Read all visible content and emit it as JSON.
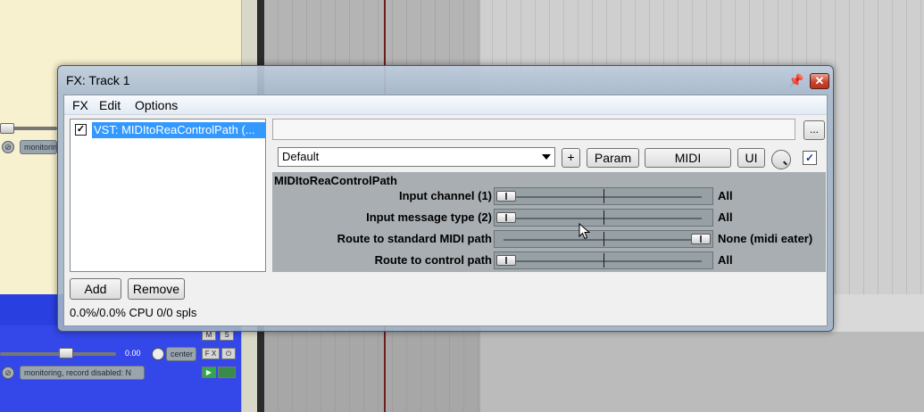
{
  "background": {
    "track": {
      "volume": "0.00",
      "pan": "center",
      "fx_label": "F X",
      "monitor_top": "monitoring",
      "monitor_bottom": "monitoring, record disabled: N",
      "mute": "M",
      "solo": "S",
      "rec_icon": "record-disabled-icon",
      "phase_icon": "phase-invert-icon"
    }
  },
  "fx_window": {
    "title": "FX: Track 1",
    "pin_icon": "pin-icon",
    "close_icon": "close-icon",
    "close_glyph": "✕",
    "menu": [
      "FX",
      "Edit",
      "Options"
    ],
    "fx_list": [
      {
        "label": "VST: MIDItoReaControlPath (...",
        "enabled": true
      }
    ],
    "add_label": "Add",
    "remove_label": "Remove",
    "cpu": "0.0%/0.0% CPU 0/0 spls",
    "dots_label": "...",
    "preset": "Default",
    "plus_label": "+",
    "param_label": "Param",
    "midi_label": "MIDI",
    "ui_label": "UI",
    "plugin_name": "MIDItoReaControlPath",
    "params": [
      {
        "label": "Input channel (1)",
        "value": "All",
        "position": 0.0
      },
      {
        "label": "Input message type (2)",
        "value": "All",
        "position": 0.0
      },
      {
        "label": "Route to standard MIDI path",
        "value": "None (midi eater)",
        "position": 1.0
      },
      {
        "label": "Route to control path",
        "value": "All",
        "position": 0.0
      }
    ]
  }
}
